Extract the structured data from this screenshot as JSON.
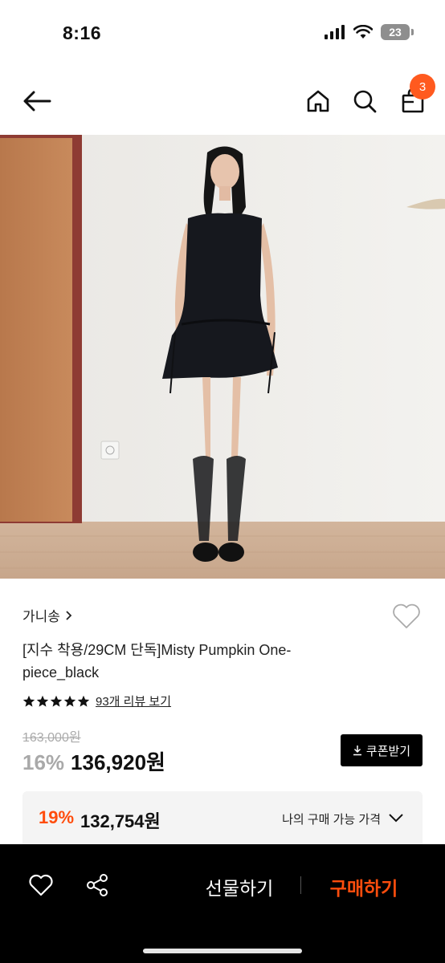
{
  "status_bar": {
    "time": "8:16",
    "battery": "23"
  },
  "nav": {
    "cart_count": "3"
  },
  "product": {
    "brand": "가니송",
    "title": "[지수 착용/29CM 단독]Misty Pumpkin One-piece_black",
    "rating_stars": 5,
    "review_link": "93개 리뷰 보기",
    "original_price": "163,000원",
    "discount": "16%",
    "price": "136,920원",
    "coupon_label": "쿠폰받기"
  },
  "my_price": {
    "discount": "19%",
    "price": "132,754원",
    "label": "나의 구매 가능 가격"
  },
  "bottom_bar": {
    "gift_label": "선물하기",
    "buy_label": "구매하기"
  },
  "colors": {
    "accent": "#ff4d0d",
    "badge": "#ff5a1f",
    "dark": "#000000"
  },
  "icons": [
    "back-arrow-icon",
    "home-icon",
    "search-icon",
    "cart-icon",
    "chevron-right-icon",
    "heart-icon",
    "star-icon",
    "download-icon",
    "chevron-down-icon",
    "share-icon"
  ]
}
